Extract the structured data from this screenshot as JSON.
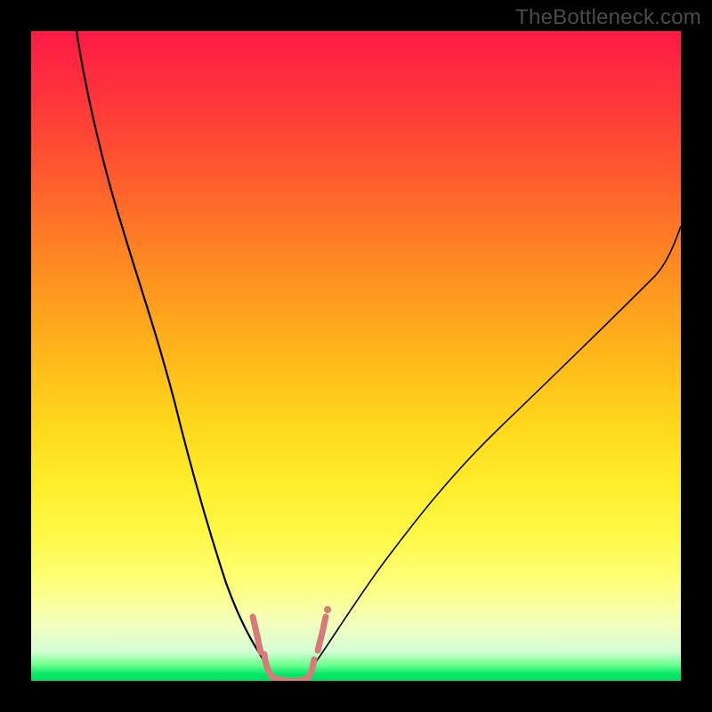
{
  "watermark": "TheBottleneck.com",
  "colors": {
    "frame": "#000000",
    "gradient_top": "#ff1b45",
    "gradient_mid": "#ffee2b",
    "gradient_bottom": "#00e060",
    "curve": "#000000",
    "marker": "#d97a7a"
  },
  "chart_data": {
    "type": "line",
    "title": "",
    "xlabel": "",
    "ylabel": "",
    "xlim": [
      0,
      100
    ],
    "ylim": [
      0,
      100
    ],
    "grid": false,
    "legend": false,
    "series": [
      {
        "name": "left-curve",
        "x": [
          7,
          10,
          14,
          18,
          22,
          26,
          30,
          33,
          35,
          36.5,
          37.5
        ],
        "y": [
          100,
          87,
          70,
          54,
          39,
          26,
          15,
          7,
          3,
          1,
          0
        ]
      },
      {
        "name": "right-curve",
        "x": [
          42,
          44,
          48,
          54,
          62,
          72,
          84,
          96,
          100
        ],
        "y": [
          0,
          2,
          7,
          15,
          26,
          39,
          53,
          66,
          70
        ]
      }
    ],
    "markers": {
      "name": "bottom-band",
      "comment": "salmon colored curly/rounded marker near curve minimum",
      "x_range": [
        34,
        44
      ],
      "y_range": [
        0,
        10
      ]
    },
    "background": {
      "type": "vertical-gradient",
      "stops": [
        {
          "pos": 0,
          "color": "#ff1b45"
        },
        {
          "pos": 50,
          "color": "#ffc41a"
        },
        {
          "pos": 80,
          "color": "#fff94a"
        },
        {
          "pos": 100,
          "color": "#00e060"
        }
      ]
    }
  }
}
